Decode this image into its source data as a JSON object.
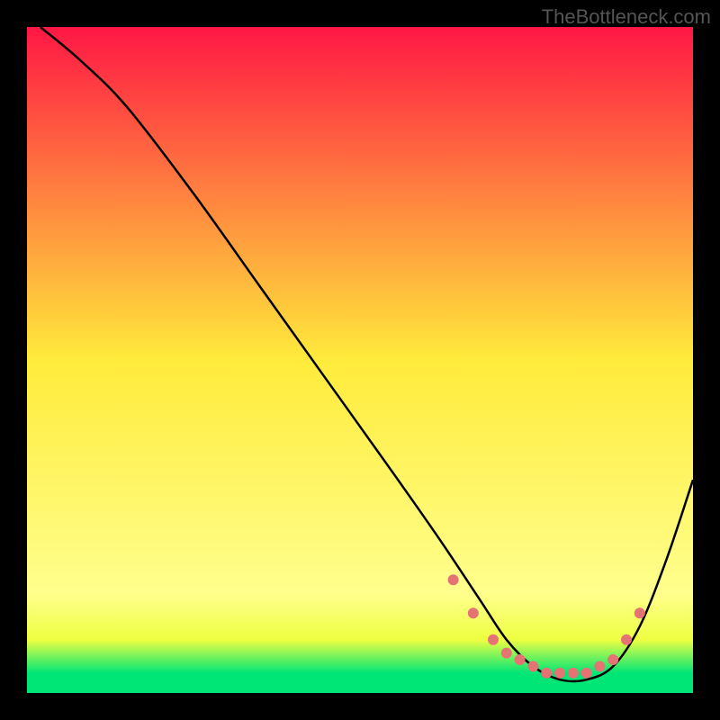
{
  "watermark": "TheBottleneck.com",
  "chart_data": {
    "type": "line",
    "title": "",
    "xlabel": "",
    "ylabel": "",
    "xlim": [
      0,
      100
    ],
    "ylim": [
      0,
      100
    ],
    "background": {
      "type": "vertical-gradient",
      "stops": [
        {
          "pos": 0,
          "color": "#ff1744"
        },
        {
          "pos": 50,
          "color": "#ffeb3b"
        },
        {
          "pos": 85,
          "color": "#ffff8d"
        },
        {
          "pos": 92,
          "color": "#eeff41"
        },
        {
          "pos": 97,
          "color": "#00e676"
        }
      ]
    },
    "series": [
      {
        "name": "curve",
        "color": "#000000",
        "x": [
          2,
          8,
          15,
          25,
          35,
          45,
          55,
          62,
          68,
          72,
          76,
          80,
          84,
          88,
          92,
          96,
          100
        ],
        "y": [
          100,
          95,
          88,
          75,
          61,
          47,
          33,
          23,
          14,
          8,
          4,
          2,
          2,
          4,
          10,
          20,
          32
        ]
      }
    ],
    "markers": {
      "name": "dots",
      "color": "#e57373",
      "radius": 6,
      "x": [
        64,
        67,
        70,
        72,
        74,
        76,
        78,
        80,
        82,
        84,
        86,
        88,
        90,
        92
      ],
      "y": [
        17,
        12,
        8,
        6,
        5,
        4,
        3,
        3,
        3,
        3,
        4,
        5,
        8,
        12
      ]
    }
  }
}
